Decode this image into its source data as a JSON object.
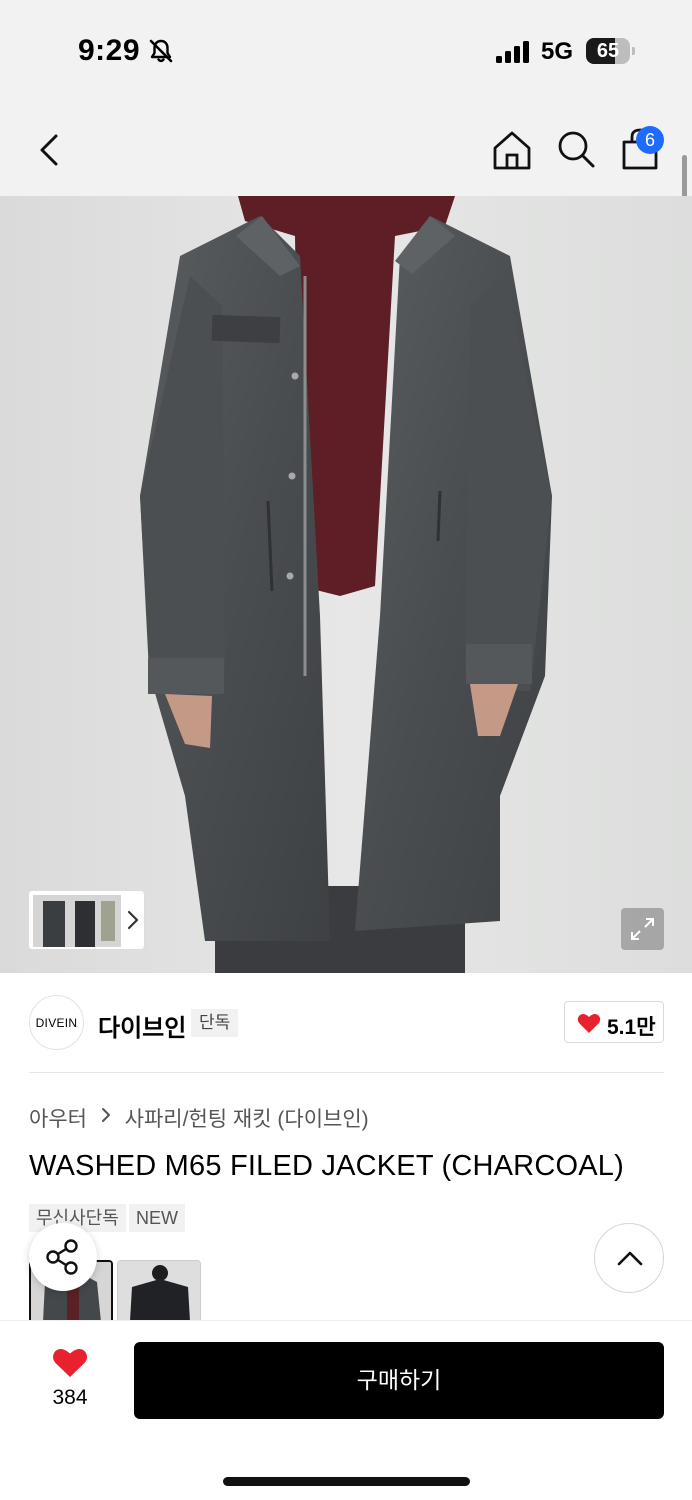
{
  "status_bar": {
    "time": "9:29",
    "network": "5G",
    "battery": "65",
    "battery_level": 0.65,
    "icons": [
      "bell-slash-icon",
      "signal-bars-icon",
      "battery-icon"
    ]
  },
  "nav": {
    "icons": [
      "back-chevron-icon",
      "home-icon",
      "search-icon",
      "shopping-bag-icon"
    ],
    "cart_count": "6"
  },
  "hero": {
    "image": "model-wearing-washed-charcoal-m65-coat",
    "icons": [
      "chevron-right-icon",
      "expand-icon"
    ]
  },
  "brand": {
    "logo_text": "DIVEIN",
    "name": "다이브인",
    "tag": "단독",
    "likes": "5.1만"
  },
  "product": {
    "breadcrumb": [
      "아우터",
      "사파리/헌팅 재킷 (다이브인)"
    ],
    "title": "WASHED M65 FILED JACKET (CHARCOAL)",
    "tags": [
      "무신사단독",
      "NEW"
    ]
  },
  "fabs": {
    "icons": [
      "share-icon",
      "chevron-up-icon"
    ]
  },
  "bottom_bar": {
    "wish_count": "384",
    "buy_label": "구매하기"
  },
  "colors": {
    "accent_blue": "#1f6bff",
    "heart_red": "#e8212e",
    "buy_black": "#000000"
  }
}
